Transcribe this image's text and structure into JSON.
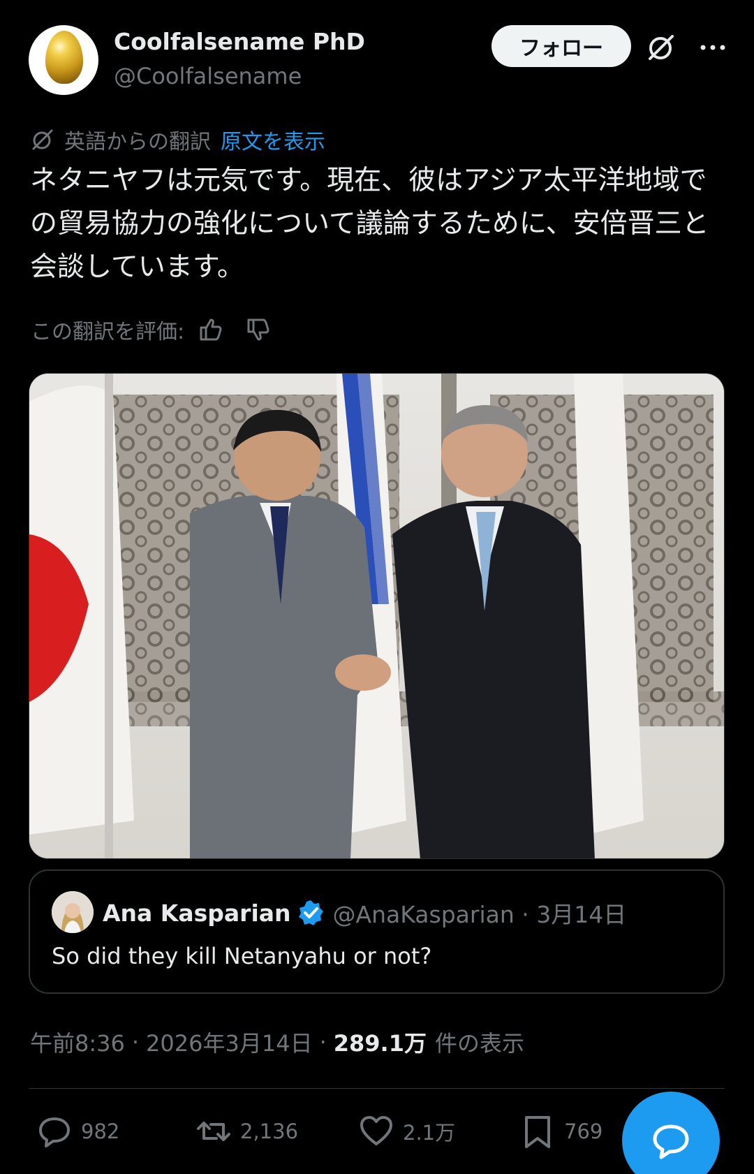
{
  "author": {
    "display_name": "Coolfalsename PhD",
    "handle": "@Coolfalsename",
    "follow_label": "フォロー"
  },
  "translation": {
    "label": "英語からの翻訳",
    "show_original": "原文を表示",
    "rate_label": "この翻訳を評価:"
  },
  "tweet": {
    "text": "ネタニヤフは元気です。現在、彼はアジア太平洋地域での貿易協力の強化について議論するために、安倍晋三と会談しています。",
    "time": "午前8:36",
    "date": "2026年3月14日",
    "views_count": "289.1万",
    "views_label": "件の表示",
    "separator": "·"
  },
  "quote": {
    "name": "Ana Kasparian",
    "handle": "@AnaKasparian · 3月14日",
    "text": "So did they kill Netanyahu or not?"
  },
  "actions": {
    "replies": "982",
    "reposts": "2,136",
    "likes": "2.1万",
    "bookmarks": "769"
  },
  "colors": {
    "accent": "#1d9bf0",
    "background": "#000000",
    "text_primary": "#e7e9ea",
    "text_secondary": "#71767b"
  }
}
